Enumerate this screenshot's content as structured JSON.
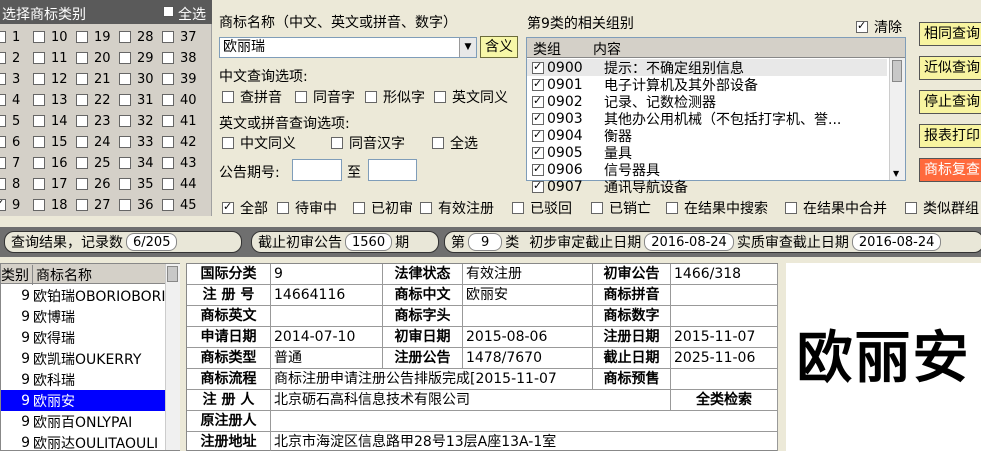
{
  "class_panel": {
    "title": "选择商标类别",
    "all_label": "全选",
    "columns": [
      [
        {
          "n": "1",
          "c": false
        },
        {
          "n": "2",
          "c": false
        },
        {
          "n": "3",
          "c": false
        },
        {
          "n": "4",
          "c": false
        },
        {
          "n": "5",
          "c": false
        },
        {
          "n": "6",
          "c": false
        },
        {
          "n": "7",
          "c": false
        },
        {
          "n": "8",
          "c": false
        },
        {
          "n": "9",
          "c": true
        }
      ],
      [
        {
          "n": "10",
          "c": false
        },
        {
          "n": "11",
          "c": false
        },
        {
          "n": "12",
          "c": false
        },
        {
          "n": "13",
          "c": false
        },
        {
          "n": "14",
          "c": false
        },
        {
          "n": "15",
          "c": false
        },
        {
          "n": "16",
          "c": false
        },
        {
          "n": "17",
          "c": false
        },
        {
          "n": "18",
          "c": false
        }
      ],
      [
        {
          "n": "19",
          "c": false
        },
        {
          "n": "20",
          "c": false
        },
        {
          "n": "21",
          "c": false
        },
        {
          "n": "22",
          "c": false
        },
        {
          "n": "23",
          "c": false
        },
        {
          "n": "24",
          "c": false
        },
        {
          "n": "25",
          "c": false
        },
        {
          "n": "26",
          "c": false
        },
        {
          "n": "27",
          "c": false
        }
      ],
      [
        {
          "n": "28",
          "c": false
        },
        {
          "n": "29",
          "c": false
        },
        {
          "n": "30",
          "c": false
        },
        {
          "n": "31",
          "c": false
        },
        {
          "n": "32",
          "c": false
        },
        {
          "n": "33",
          "c": false
        },
        {
          "n": "34",
          "c": false
        },
        {
          "n": "35",
          "c": false
        },
        {
          "n": "36",
          "c": false
        }
      ],
      [
        {
          "n": "37",
          "c": false
        },
        {
          "n": "38",
          "c": false
        },
        {
          "n": "39",
          "c": false
        },
        {
          "n": "40",
          "c": false
        },
        {
          "n": "41",
          "c": false
        },
        {
          "n": "42",
          "c": false
        },
        {
          "n": "43",
          "c": false
        },
        {
          "n": "44",
          "c": false
        },
        {
          "n": "45",
          "c": false
        }
      ]
    ]
  },
  "search": {
    "name_label": "商标名称（中文、英文或拼音、数字）",
    "name_value": "欧丽瑞",
    "meaning_button": "含义",
    "cn_options_label": "中文查询选项:",
    "cn_options": [
      "查拼音",
      "同音字",
      "形似字",
      "英文同义"
    ],
    "en_options_label": "英文或拼音查询选项:",
    "en_options": [
      "中文同义",
      "同音汉字",
      "全选"
    ],
    "issue_label": "公告期号:",
    "issue_to": "至"
  },
  "groups": {
    "title": "第9类的相关组别",
    "clear_label": "清除",
    "col_group": "类组",
    "col_content": "内容",
    "rows": [
      {
        "code": "0900",
        "text": "提示：不确定组别信息"
      },
      {
        "code": "0901",
        "text": "电子计算机及其外部设备"
      },
      {
        "code": "0902",
        "text": "记录、记数检测器"
      },
      {
        "code": "0903",
        "text": "其他办公用机械（不包括打字机、誉..."
      },
      {
        "code": "0904",
        "text": "衡器"
      },
      {
        "code": "0905",
        "text": "量具"
      },
      {
        "code": "0906",
        "text": "信号器具"
      },
      {
        "code": "0907",
        "text": "通讯导航设备"
      }
    ]
  },
  "right_buttons": [
    "相同查询",
    "近似查询",
    "停止查询",
    "报表打印",
    "商标复查"
  ],
  "filters": [
    {
      "label": "全部",
      "checked": true
    },
    {
      "label": "待审中",
      "checked": false
    },
    {
      "label": "已初审",
      "checked": false
    },
    {
      "label": "有效注册",
      "checked": false
    },
    {
      "label": "已驳回",
      "checked": false
    },
    {
      "label": "已销亡",
      "checked": false
    },
    {
      "label": "在结果中搜索",
      "checked": false
    },
    {
      "label": "在结果中合并",
      "checked": false
    },
    {
      "label": "类似群组",
      "checked": false
    }
  ],
  "status": {
    "result_label": "查询结果，记录数",
    "result_count": "6/205",
    "cutoff_label": "截止初审公告",
    "cutoff_value": "1560",
    "cutoff_unit": "期",
    "class_prefix": "第",
    "class_value": "9",
    "class_suffix": "类",
    "prelim_label": "初步审定截止日期",
    "prelim_date": "2016-08-24",
    "substantive_label": "实质审查截止日期",
    "substantive_date": "2016-08-24"
  },
  "results": {
    "col_class": "类别",
    "col_name": "商标名称",
    "rows": [
      {
        "cls": "9",
        "name": "欧铂瑞OBORIOBORI",
        "sel": false
      },
      {
        "cls": "9",
        "name": "欧博瑞",
        "sel": false
      },
      {
        "cls": "9",
        "name": "欧得瑞",
        "sel": false
      },
      {
        "cls": "9",
        "name": "欧凯瑞OUKERRY",
        "sel": false
      },
      {
        "cls": "9",
        "name": "欧科瑞",
        "sel": false
      },
      {
        "cls": "9",
        "name": "欧丽安",
        "sel": true
      },
      {
        "cls": "9",
        "name": "欧丽百ONLYPAI",
        "sel": false
      },
      {
        "cls": "9",
        "name": "欧丽达OULITAOULI",
        "sel": false
      }
    ]
  },
  "detail": {
    "intl_class_label": "国际分类",
    "intl_class": "9",
    "legal_status_label": "法律状态",
    "legal_status": "有效注册",
    "prelim_pub_label": "初审公告",
    "prelim_pub": "1466/318",
    "reg_no_label": "注 册 号",
    "reg_no": "14664116",
    "cn_name_label": "商标中文",
    "cn_name": "欧丽安",
    "pinyin_label": "商标拼音",
    "pinyin": "",
    "en_label": "商标英文",
    "en": "",
    "initial_label": "商标字头",
    "initial": "",
    "digits_label": "商标数字",
    "digits": "",
    "apply_date_label": "申请日期",
    "apply_date": "2014-07-10",
    "prelim_date_label": "初审日期",
    "prelim_date": "2015-08-06",
    "reg_date_label": "注册日期",
    "reg_date": "2015-11-07",
    "type_label": "商标类型",
    "type": "普通",
    "reg_pub_label": "注册公告",
    "reg_pub": "1478/7670",
    "expire_label": "截止日期",
    "expire": "2025-11-06",
    "flow_label": "商标流程",
    "flow": "商标注册申请注册公告排版完成[2015-11-07",
    "presale_label": "商标预售",
    "presale": "",
    "registrant_label": "注 册 人",
    "registrant": "北京砺石高科信息技术有限公司",
    "all_class_search": "全类检索",
    "orig_registrant_label": "原注册人",
    "orig_registrant": "",
    "address_label": "注册地址",
    "address": "北京市海淀区信息路甲28号13层A座13A-1室"
  },
  "logo_text": "欧丽安"
}
